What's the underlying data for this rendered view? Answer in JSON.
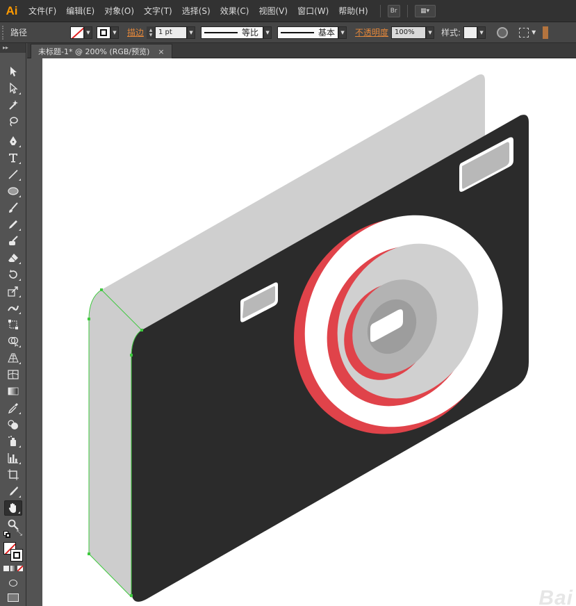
{
  "app": {
    "logo": "Ai"
  },
  "menu": [
    "文件(F)",
    "编辑(E)",
    "对象(O)",
    "文字(T)",
    "选择(S)",
    "效果(C)",
    "视图(V)",
    "窗口(W)",
    "帮助(H)"
  ],
  "menubar_buttons": {
    "bridge": "Br",
    "arrange": "▦▾"
  },
  "controlbar": {
    "selection_type": "路径",
    "stroke_label": "描边",
    "stroke_weight": "1 pt",
    "profile_label": "等比",
    "brush_label": "基本",
    "opacity_label": "不透明度",
    "opacity_value": "100%",
    "style_label": "样式:"
  },
  "document": {
    "tab_title": "未标题-1* @ 200% (RGB/预览)",
    "close": "×"
  },
  "tools": [
    "selection-tool",
    "direct-selection-tool",
    "magic-wand-tool",
    "lasso-tool",
    "pen-tool",
    "type-tool",
    "line-tool",
    "ellipse-tool",
    "paintbrush-tool",
    "pencil-tool",
    "blob-brush-tool",
    "eraser-tool",
    "rotate-tool",
    "scale-tool",
    "width-tool",
    "free-transform-tool",
    "shape-builder-tool",
    "perspective-grid-tool",
    "mesh-tool",
    "gradient-tool",
    "eyedropper-tool",
    "blend-tool",
    "symbol-sprayer-tool",
    "column-graph-tool",
    "artboard-tool",
    "slice-tool",
    "hand-tool",
    "zoom-tool"
  ],
  "colors": {
    "camera_body": "#2b2b2b",
    "camera_side": "#cfcfcf",
    "lens_red": "#e0434a",
    "lens_ring": "#ffffff",
    "lens_light": "#d0d0d0",
    "lens_mid": "#b3b3b3",
    "lens_dark": "#9d9d9d",
    "selection_path": "#3ec93e"
  },
  "watermark": "Bai"
}
